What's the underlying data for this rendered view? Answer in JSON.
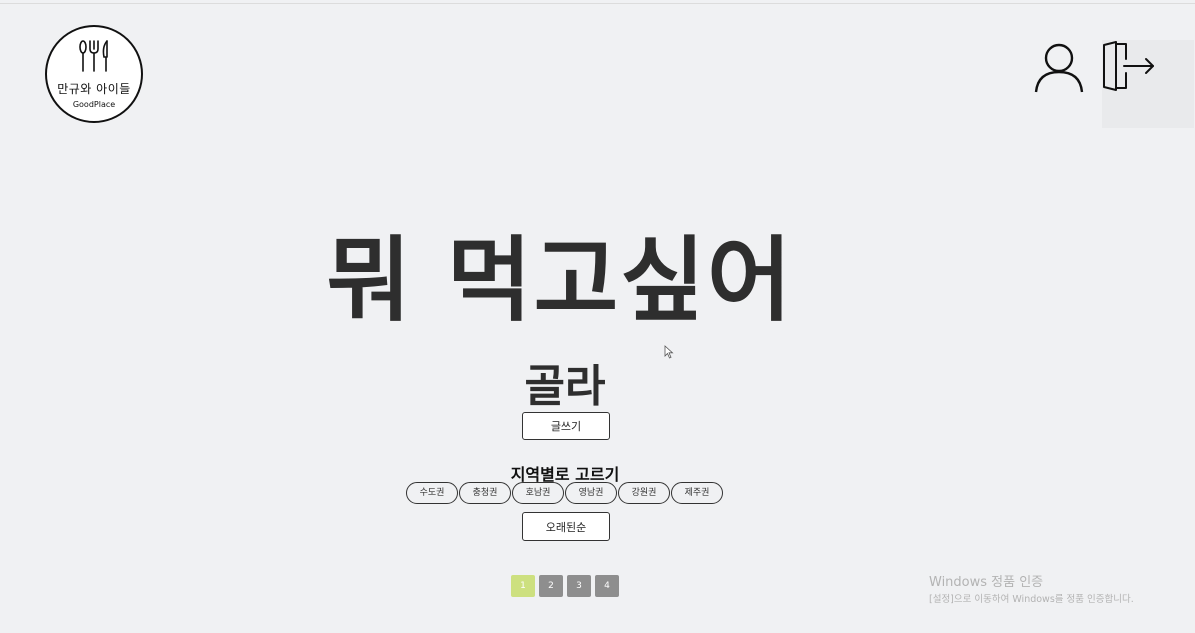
{
  "logo": {
    "name": "만규와 아이들",
    "subtitle": "GoodPlace"
  },
  "header": {
    "profile_icon": "user-icon",
    "logout_icon": "logout-icon"
  },
  "hero": {
    "headline": "뭐 먹고싶어",
    "subheadline": "골라"
  },
  "write_button": {
    "label": "글쓰기"
  },
  "region_filter": {
    "title": "지역별로 고르기",
    "regions": [
      "수도권",
      "충청권",
      "호남권",
      "영남권",
      "강원권",
      "제주권"
    ]
  },
  "sort_button": {
    "label": "오래된순"
  },
  "pagination": {
    "pages": [
      "1",
      "2",
      "3",
      "4"
    ],
    "current": "1"
  },
  "watermark": {
    "line1": "Windows 정품 인증",
    "line2": "[설정]으로 이동하여 Windows를 정품 인증합니다."
  },
  "colors": {
    "background": "#f0f1f3",
    "active_page": "#cde07f",
    "inactive_page": "#8e8e8e"
  }
}
